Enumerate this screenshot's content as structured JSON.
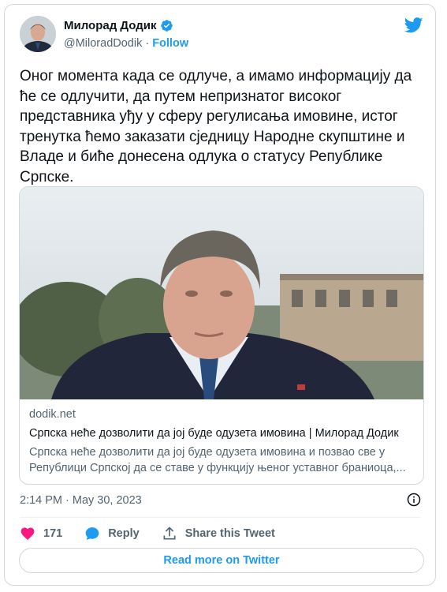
{
  "author": {
    "name": "Милорад Додик",
    "handle": "@MiloradDodik",
    "separator": "·",
    "follow_label": "Follow",
    "avatar_icon": "user-avatar"
  },
  "tweet": {
    "text": "Оног момента када се одлуче, а имамо информацију да ће се одлучити, да путем непризнатог високог представника уђу у сферу регулисања имовине, истог тренутка ћемо заказати сједницу Народне скупштине и Владе и биће донесена одлука о статусу Републике Српске."
  },
  "link_card": {
    "domain": "dodik.net",
    "title": "Српска неће дозволити да јој буде одузета имовина | Милорад Додик",
    "description": "Српска неће дозволити да јој буде одузета имовина и позвао све у Републици Српској да се ставе у функцију њеног уставног браниоца,..."
  },
  "timestamp": "2:14 PM · May 30, 2023",
  "actions": {
    "like_count": "171",
    "reply_label": "Reply",
    "share_label": "Share this Tweet"
  },
  "read_more_label": "Read more on Twitter",
  "colors": {
    "accent": "#1d9bf0",
    "like": "#f91880",
    "muted": "#536471",
    "border": "#cfd9de"
  }
}
